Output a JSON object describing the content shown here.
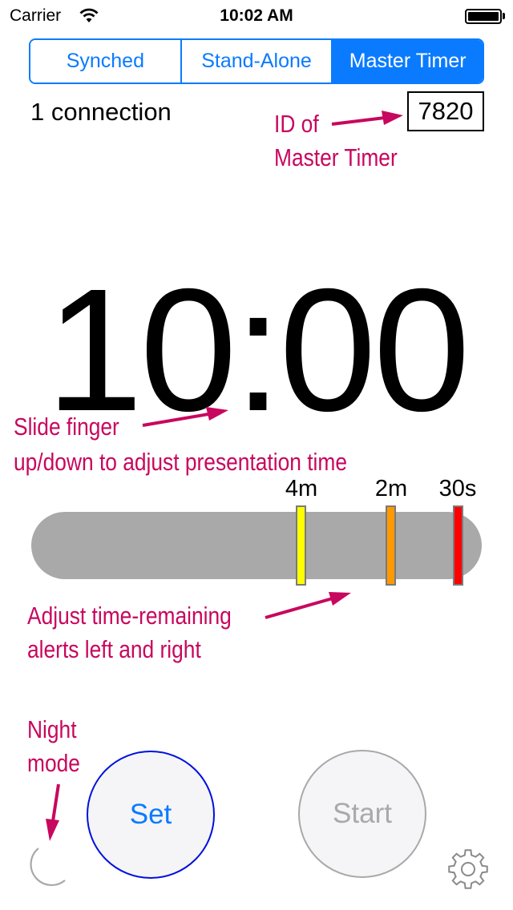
{
  "status_bar": {
    "carrier": "Carrier",
    "time": "10:02 AM",
    "wifi_icon": "wifi-icon",
    "battery_icon": "battery-icon",
    "battery_level": 1.0
  },
  "mode_control": {
    "segments": [
      {
        "label": "Synched",
        "selected": false
      },
      {
        "label": "Stand-Alone",
        "selected": false
      },
      {
        "label": "Master Timer",
        "selected": true
      }
    ],
    "accent_color": "#0a7bff"
  },
  "connections_text": "1 connection",
  "master_timer_id": "7820",
  "timer_display": "10:00",
  "alerts": [
    {
      "label": "4m",
      "color": "#ffff00"
    },
    {
      "label": "2m",
      "color": "#ff9900"
    },
    {
      "label": "30s",
      "color": "#ff0000"
    }
  ],
  "buttons": {
    "set_label": "Set",
    "start_label": "Start",
    "night_mode_icon": "moon-icon",
    "settings_icon": "gear-icon"
  },
  "annotations": {
    "color": "#c8075e",
    "id_line1": "ID of",
    "id_line2": "Master Timer",
    "slide_line1": "Slide finger",
    "slide_line2": "up/down to adjust presentation time",
    "alerts_line1": "Adjust time-remaining",
    "alerts_line2": "alerts left and right",
    "night_line1": "Night",
    "night_line2": "mode"
  }
}
